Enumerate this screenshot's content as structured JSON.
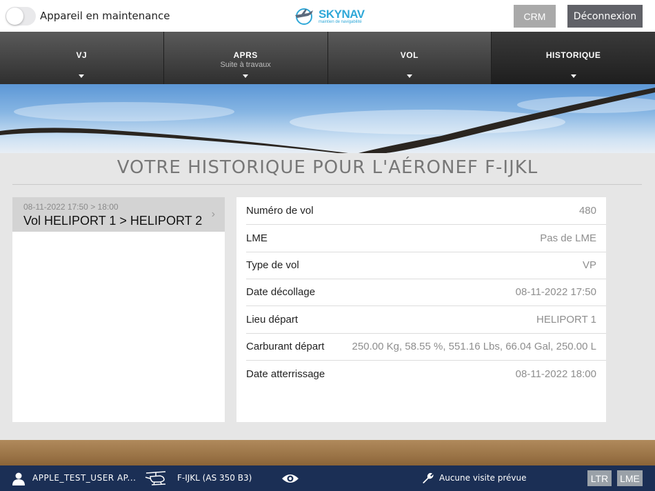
{
  "header": {
    "maintenance_label": "Appareil en maintenance",
    "maintenance_on": false,
    "logo_brand": "SKYNAV",
    "logo_tagline": "maintien de navigabilité",
    "crm_label": "CRM",
    "logout_label": "Déconnexion"
  },
  "tabs": [
    {
      "label": "VJ",
      "sub": ""
    },
    {
      "label": "APRS",
      "sub": "Suite à travaux"
    },
    {
      "label": "VOL",
      "sub": ""
    },
    {
      "label": "HISTORIQUE",
      "sub": "",
      "active": true
    }
  ],
  "page": {
    "title": "VOTRE HISTORIQUE POUR L'AÉRONEF F-IJKL"
  },
  "flights": [
    {
      "date": "08-11-2022 17:50 > 18:00",
      "route": "Vol HELIPORT 1 > HELIPORT 2",
      "chevron": "›"
    }
  ],
  "details": [
    {
      "label": "Numéro de vol",
      "value": "480"
    },
    {
      "label": "LME",
      "value": "Pas de LME"
    },
    {
      "label": "Type de vol",
      "value": "VP"
    },
    {
      "label": "Date décollage",
      "value": "08-11-2022 17:50"
    },
    {
      "label": "Lieu départ",
      "value": "HELIPORT 1"
    },
    {
      "label": "Carburant départ",
      "value": "250.00 Kg, 58.55 %, 551.16 Lbs, 66.04 Gal, 250.00 L"
    },
    {
      "label": "Date atterrissage",
      "value": "08-11-2022 18:00"
    }
  ],
  "footer": {
    "user": "APPLE_TEST_USER AP...",
    "aircraft": "F-IJKL (AS 350 B3)",
    "visit": "Aucune visite prévue",
    "ltr_label": "LTR",
    "lme_label": "LME"
  },
  "icons": {
    "user": "user-icon",
    "helicopter": "helicopter-icon",
    "eye": "eye-icon",
    "wrench": "wrench-icon",
    "chevron": "chevron-right-icon"
  },
  "colors": {
    "brand": "#2fa8d8",
    "footer_bg": "#1b2f55",
    "logout_bg": "#606167",
    "crm_bg": "#a9a9a9"
  }
}
